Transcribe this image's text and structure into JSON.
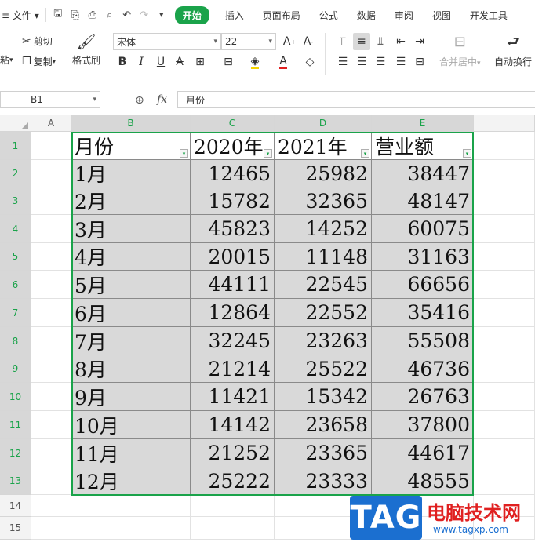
{
  "menubar": {
    "file_label": "文件",
    "tabs": [
      {
        "label": "开始",
        "active": true
      },
      {
        "label": "插入",
        "active": false
      },
      {
        "label": "页面布局",
        "active": false
      },
      {
        "label": "公式",
        "active": false
      },
      {
        "label": "数据",
        "active": false
      },
      {
        "label": "审阅",
        "active": false
      },
      {
        "label": "视图",
        "active": false
      },
      {
        "label": "开发工具",
        "active": false
      }
    ]
  },
  "ribbon": {
    "cut_label": "剪切",
    "copy_label": "复制",
    "paste_label": "粘",
    "format_painter_label": "格式刷",
    "font_name": "宋体",
    "font_size": "22",
    "merge_label": "合并居中",
    "wrap_label": "自动换行"
  },
  "formula_bar": {
    "name_box": "B1",
    "fx_label": "fx",
    "content": "月份"
  },
  "grid": {
    "col_headers": [
      "A",
      "B",
      "C",
      "D",
      "E"
    ],
    "row_headers": [
      "1",
      "2",
      "3",
      "4",
      "5",
      "6",
      "7",
      "8",
      "9",
      "10",
      "11",
      "12",
      "13",
      "14",
      "15"
    ],
    "table_header": [
      "月份",
      "2020年",
      "2021年",
      "营业额"
    ],
    "rows": [
      {
        "month": "1月",
        "y2020": "12465",
        "y2021": "25982",
        "revenue": "38447"
      },
      {
        "month": "2月",
        "y2020": "15782",
        "y2021": "32365",
        "revenue": "48147"
      },
      {
        "month": "3月",
        "y2020": "45823",
        "y2021": "14252",
        "revenue": "60075"
      },
      {
        "month": "4月",
        "y2020": "20015",
        "y2021": "11148",
        "revenue": "31163"
      },
      {
        "month": "5月",
        "y2020": "44111",
        "y2021": "22545",
        "revenue": "66656"
      },
      {
        "month": "6月",
        "y2020": "12864",
        "y2021": "22552",
        "revenue": "35416"
      },
      {
        "month": "7月",
        "y2020": "32245",
        "y2021": "23263",
        "revenue": "55508"
      },
      {
        "month": "8月",
        "y2020": "21214",
        "y2021": "25522",
        "revenue": "46736"
      },
      {
        "month": "9月",
        "y2020": "11421",
        "y2021": "15342",
        "revenue": "26763"
      },
      {
        "month": "10月",
        "y2020": "14142",
        "y2021": "23658",
        "revenue": "37800"
      },
      {
        "month": "11月",
        "y2020": "21252",
        "y2021": "23365",
        "revenue": "44617"
      },
      {
        "month": "12月",
        "y2020": "25222",
        "y2021": "23333",
        "revenue": "48555"
      }
    ]
  },
  "watermark": {
    "logo_text": "TAG",
    "site_name": "电脑技术网",
    "url": "www.tagxp.com"
  },
  "colors": {
    "accent_green": "#1aa34a",
    "watermark_blue": "#1b6fd0",
    "watermark_red": "#e02020"
  }
}
